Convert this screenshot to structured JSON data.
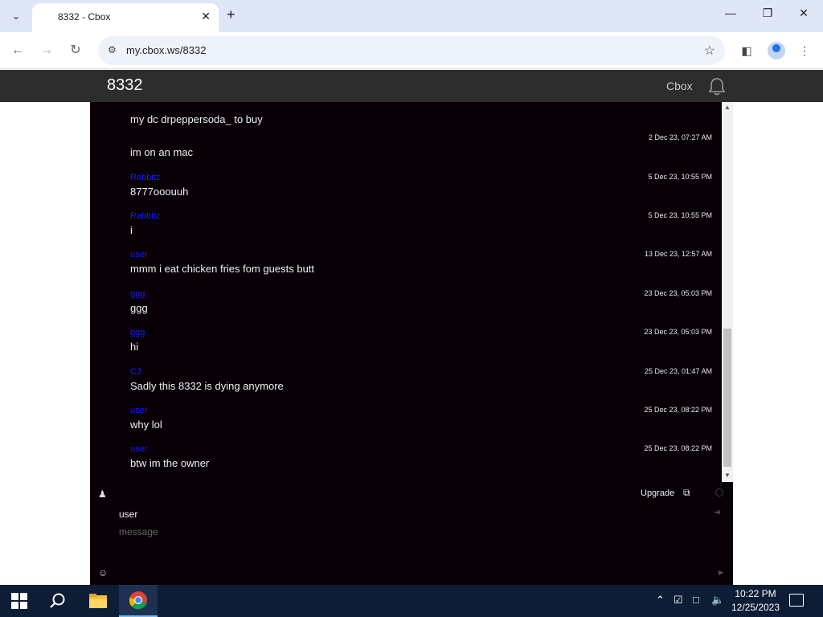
{
  "browser": {
    "tab_title": "8332 - Cbox",
    "url": "my.cbox.ws/8332"
  },
  "page": {
    "title": "8332",
    "cbox_link": "Cbox"
  },
  "messages": [
    {
      "author": "",
      "time": "",
      "text": "my dc drpeppersoda_ to buy"
    },
    {
      "author": "",
      "time": "2 Dec 23, 07:27 AM",
      "text": "im on an mac"
    },
    {
      "author": "Rabbitz",
      "time": "5 Dec 23, 10:55 PM",
      "text": "8777ooouuh"
    },
    {
      "author": "Rabbitz",
      "time": "5 Dec 23, 10:55 PM",
      "text": "i"
    },
    {
      "author": "user",
      "time": "13 Dec 23, 12:57 AM",
      "text": "mmm i eat chicken fries fom guests butt"
    },
    {
      "author": "ggg",
      "time": "23 Dec 23, 05:03 PM",
      "text": "ggg"
    },
    {
      "author": "ggg",
      "time": "23 Dec 23, 05:03 PM",
      "text": "hi"
    },
    {
      "author": "CJ",
      "time": "25 Dec 23, 01:47 AM",
      "text": "Sadly this 8332 is dying anymore"
    },
    {
      "author": "user",
      "time": "25 Dec 23, 08:22 PM",
      "text": "why lol"
    },
    {
      "author": "user",
      "time": "25 Dec 23, 08:22 PM",
      "text": "btw im the owner"
    }
  ],
  "form": {
    "upgrade_label": "Upgrade",
    "name_value": "user",
    "message_placeholder": "message"
  },
  "taskbar": {
    "time": "10:22 PM",
    "date": "12/25/2023"
  },
  "colors": {
    "chat_bg": "#080006",
    "author": "#1a1aff",
    "header_bg": "#2d2d2d",
    "taskbar_bg": "#0e1d36"
  }
}
